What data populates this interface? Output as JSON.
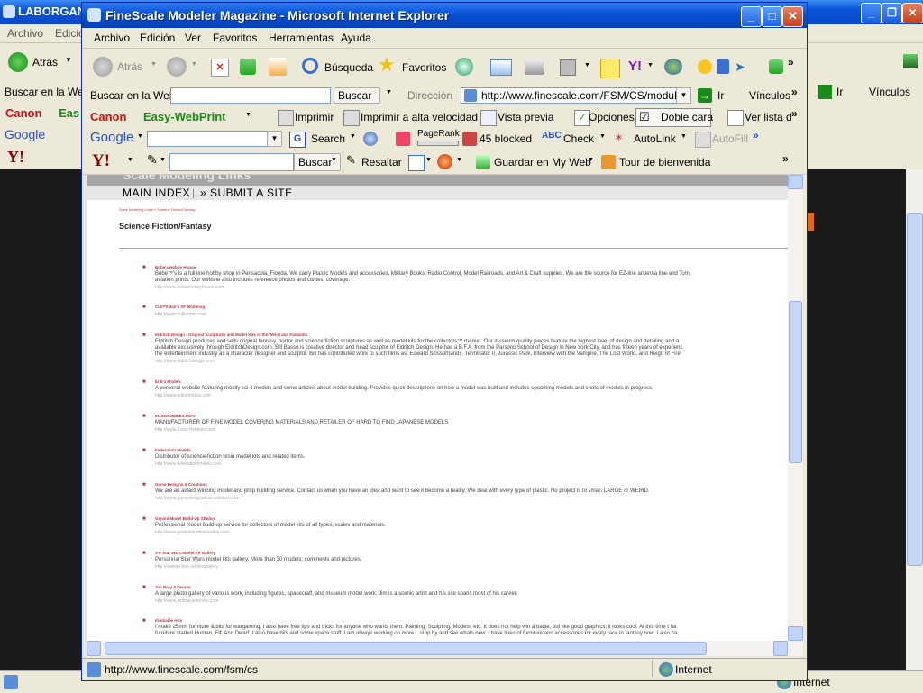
{
  "background_window": {
    "title": "LABORGAN",
    "menu": [
      "Archivo",
      "Edició"
    ],
    "back_label": "Atrás",
    "search_label": "Buscar en la Web",
    "go_label": "Ir",
    "links_label": "Vínculos",
    "canon_label": "Canon",
    "easy_label": "Eas",
    "google_label": "Google",
    "status_zone": "Internet"
  },
  "window": {
    "title": "FineScale Modeler Magazine - Microsoft Internet Explorer",
    "menu": [
      "Archivo",
      "Edición",
      "Ver",
      "Favoritos",
      "Herramientas",
      "Ayuda"
    ],
    "toolbar": {
      "back": "Atrás",
      "search": "Búsqueda",
      "favorites": "Favoritos"
    },
    "address_bar": {
      "search_label": "Buscar en la Web",
      "search_button": "Buscar",
      "address_label": "Dirección",
      "url": "http://www.finescale.com/FSM/CS/modules/l",
      "go_label": "Ir",
      "links_label": "Vínculos"
    },
    "canon_bar": {
      "brand": "Canon",
      "product": "Easy-WebPrint",
      "print": "Imprimir",
      "print_fast": "Imprimir a alta velocidad",
      "preview": "Vista previa",
      "options": "Opciones",
      "duplex": "Doble cara",
      "list": "Ver lista d"
    },
    "google_bar": {
      "brand": "Google",
      "search": "Search",
      "pagerank": "PageRank",
      "blocked": "45 blocked",
      "check": "Check",
      "autolink": "AutoLink",
      "autofill": "AutoFill"
    },
    "yahoo_bar": {
      "brand": "Y!",
      "search": "Buscar",
      "highlight": "Resaltar",
      "save": "Guardar en My Web",
      "tour": "Tour de bienvenida"
    },
    "status": {
      "url": "http://www.finescale.com/fsm/cs",
      "zone": "Internet"
    }
  },
  "page": {
    "header_title": "Scale Modeling Links",
    "nav": [
      "MAIN INDEX",
      "|",
      "» SUBMIT A SITE"
    ],
    "breadcrumb": "Scale Modeling Links  »  Science Fiction/Fantasy",
    "section_title": "Science Fiction/Fantasy",
    "entries": [
      {
        "name": "Bobe's Hobby House",
        "desc": [
          "Bobe™'s is a full line hobby shop in Pensacola, Florida. We carry Plastic Models and accessories, Military Books, Radio Control, Model Railroads, and Art & Craft supplies. We are the source for EZ-line antenna line and Tom",
          "aviation prints. Our website also includes reference photos and contest coverage."
        ],
        "url": "http://www.bobeshobbyhouse.com"
      },
      {
        "name": "CultTVMan's SF Modeling",
        "desc": [],
        "url": "http://www.culttvman.com"
      },
      {
        "name": "Eldritch Design - Original Sculptures and Model Kits of the Weird and Fantastic",
        "desc": [
          "Eldritch Design produces and sells original fantasy, horror and science fiction sculptures as well as model kits for the collectors™ market. Our museum quality pieces feature the highest level of design and detailing and a",
          "available exclusively through EldritchDesign.com. Bill Basso is creative director and head sculptor of Eldritch Design. He has a B.F.A. from the Parsons School of Design in New York City, and has fifteen years of experienc",
          "the entertainment industry as a character designer and sculptor. Bill has contributed work to such films as: Edward Scissorhands, Terminator II, Jurassic Park, Interview with the Vampire, The Lost World, and Reign of Fire"
        ],
        "url": "http://www.eldritchdesign.com"
      },
      {
        "name": "Erik's Models",
        "desc": [
          "A personal website featuring mostly sci-fi models and some articles about model building. Provides quick descriptions on how a model was built and includes upcoming models and shots of models in progress."
        ],
        "url": "http://www.eriksmodels.com"
      },
      {
        "name": "EUSEHOBBIES INFO",
        "desc": [
          "MANUFACTURER OF FINE MODEL COVERING MATERIALS AND RETAILER OF HARD TO FIND JAPANESE MODELS"
        ],
        "url": "http://www.Euse-Hobbies.com"
      },
      {
        "name": "Federation Models",
        "desc": [
          "Distributor of science-fiction resin model kits and related items."
        ],
        "url": "http://www.federationmodels.com"
      },
      {
        "name": "Game Designs & Creations",
        "desc": [
          "We are an award winning model and prop building service. Contact us when you have an idea and want to see it become a reality. We deal with every type of plastic. No project is to small, LARGE or WEIRD."
        ],
        "url": "http://www.gamedesignsandcreations.com"
      },
      {
        "name": "Gemini Model Build-Up Studios",
        "desc": [
          "Professional model build-up service for collectors of model kits of all types, scales and materials."
        ],
        "url": "http://www.geministudiosmodels.com"
      },
      {
        "name": "J-P Star Wars Model Kit Gallery",
        "desc": [
          "Personnal Star Wars model kits gallery. More than 30 models: comments and pictures."
        ],
        "url": "http://sweets.free.net/kitsgallery"
      },
      {
        "name": "Jim Bray Artworks",
        "desc": [
          "A large photo gallery of various work, including figures, spacecraft, and museum model work. Jim is a scenic artist and his site spans most of his career."
        ],
        "url": "http://www.jimbrayartworks.com"
      },
      {
        "name": "Kimbalee Arts",
        "desc": [
          "I make 25mm furniture & bits for wargaming. I also have free tips and tricks for anyone who wants them. Painting, Sculpting, Models, etc. It does not help win a battle, but like good graphics, it looks cool. At this time I ha",
          "furniture started Human, Elf, And Dwarf. I also have bits and some space stuff. I am always working on more....stop by and see whats new. I have lines of furniture and accessories for every race in fantasy now. I also ha"
        ],
        "url": ""
      }
    ]
  },
  "colors": {
    "titlebar": "#0850d6",
    "chrome": "#ece9d8",
    "link_red": "#b34",
    "header_gray": "#a6a6a6"
  }
}
